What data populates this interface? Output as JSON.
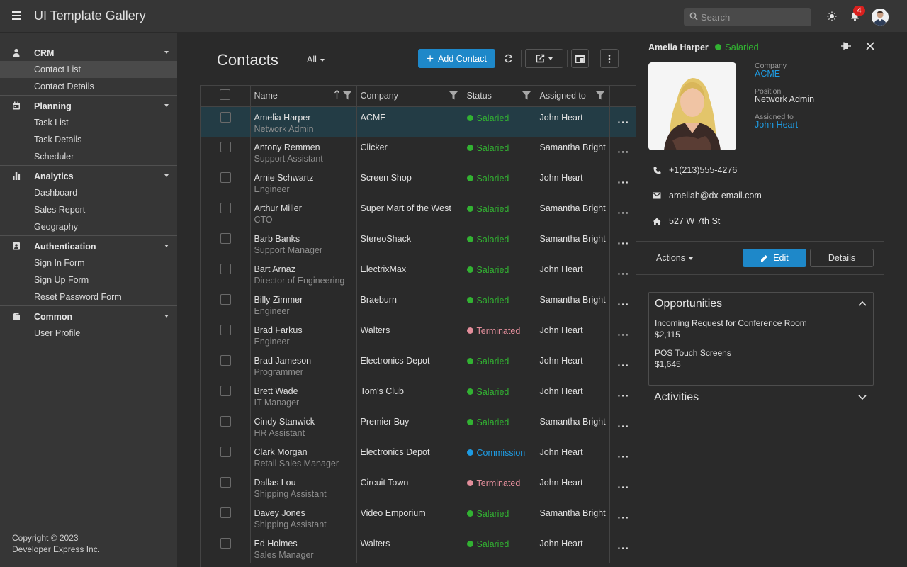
{
  "app": {
    "title": "UI Template Gallery",
    "search_placeholder": "Search",
    "notification_count": "4"
  },
  "sidebar": {
    "groups": [
      {
        "label": "CRM",
        "icon": "person-icon",
        "items": [
          {
            "label": "Contact List",
            "active": true
          },
          {
            "label": "Contact Details"
          }
        ]
      },
      {
        "label": "Planning",
        "icon": "calendar-icon",
        "items": [
          {
            "label": "Task List"
          },
          {
            "label": "Task Details"
          },
          {
            "label": "Scheduler"
          }
        ]
      },
      {
        "label": "Analytics",
        "icon": "chart-icon",
        "items": [
          {
            "label": "Dashboard"
          },
          {
            "label": "Sales Report"
          },
          {
            "label": "Geography"
          }
        ]
      },
      {
        "label": "Authentication",
        "icon": "id-card-icon",
        "items": [
          {
            "label": "Sign In Form"
          },
          {
            "label": "Sign Up Form"
          },
          {
            "label": "Reset Password Form"
          }
        ]
      },
      {
        "label": "Common",
        "icon": "folder-icon",
        "items": [
          {
            "label": "User Profile"
          }
        ]
      }
    ],
    "copyright_line1": "Copyright © 2023",
    "copyright_line2": "Developer Express Inc."
  },
  "main": {
    "title": "Contacts",
    "filter_value": "All",
    "add_label": "Add Contact",
    "columns": [
      "Name",
      "Company",
      "Status",
      "Assigned to"
    ],
    "rows": [
      {
        "name": "Amelia Harper",
        "position": "Network Admin",
        "company": "ACME",
        "status": "Salaried",
        "assigned": "John Heart",
        "selected": true
      },
      {
        "name": "Antony Remmen",
        "position": "Support Assistant",
        "company": "Clicker",
        "status": "Salaried",
        "assigned": "Samantha Bright"
      },
      {
        "name": "Arnie Schwartz",
        "position": "Engineer",
        "company": "Screen Shop",
        "status": "Salaried",
        "assigned": "John Heart"
      },
      {
        "name": "Arthur Miller",
        "position": "CTO",
        "company": "Super Mart of the West",
        "status": "Salaried",
        "assigned": "Samantha Bright"
      },
      {
        "name": "Barb Banks",
        "position": "Support Manager",
        "company": "StereoShack",
        "status": "Salaried",
        "assigned": "Samantha Bright"
      },
      {
        "name": "Bart Arnaz",
        "position": "Director of Engineering",
        "company": "ElectrixMax",
        "status": "Salaried",
        "assigned": "John Heart"
      },
      {
        "name": "Billy Zimmer",
        "position": "Engineer",
        "company": "Braeburn",
        "status": "Salaried",
        "assigned": "Samantha Bright"
      },
      {
        "name": "Brad Farkus",
        "position": "Engineer",
        "company": "Walters",
        "status": "Terminated",
        "assigned": "John Heart"
      },
      {
        "name": "Brad Jameson",
        "position": "Programmer",
        "company": "Electronics Depot",
        "status": "Salaried",
        "assigned": "John Heart"
      },
      {
        "name": "Brett Wade",
        "position": "IT Manager",
        "company": "Tom's Club",
        "status": "Salaried",
        "assigned": "John Heart"
      },
      {
        "name": "Cindy Stanwick",
        "position": "HR Assistant",
        "company": "Premier Buy",
        "status": "Salaried",
        "assigned": "Samantha Bright"
      },
      {
        "name": "Clark Morgan",
        "position": "Retail Sales Manager",
        "company": "Electronics Depot",
        "status": "Commission",
        "assigned": "John Heart"
      },
      {
        "name": "Dallas Lou",
        "position": "Shipping Assistant",
        "company": "Circuit Town",
        "status": "Terminated",
        "assigned": "John Heart"
      },
      {
        "name": "Davey Jones",
        "position": "Shipping Assistant",
        "company": "Video Emporium",
        "status": "Salaried",
        "assigned": "Samantha Bright"
      },
      {
        "name": "Ed Holmes",
        "position": "Sales Manager",
        "company": "Walters",
        "status": "Salaried",
        "assigned": "John Heart"
      }
    ]
  },
  "panel": {
    "name": "Amelia Harper",
    "status": "Salaried",
    "company_label": "Company",
    "company": "ACME",
    "position_label": "Position",
    "position": "Network Admin",
    "assigned_label": "Assigned to",
    "assigned": "John Heart",
    "phone": "+1(213)555-4276",
    "email": "ameliah@dx-email.com",
    "address": "527 W 7th St",
    "actions_label": "Actions",
    "edit_label": "Edit",
    "details_label": "Details",
    "opportunities_title": "Opportunities",
    "opportunities": [
      {
        "title": "Incoming Request for Conference Room",
        "amount": "$2,115"
      },
      {
        "title": "POS Touch Screens",
        "amount": "$1,645"
      }
    ],
    "activities_title": "Activities"
  },
  "colors": {
    "accent": "#1e88c9",
    "salaried": "#32b232",
    "terminated": "#e38e9b",
    "commission": "#1e9be2"
  }
}
